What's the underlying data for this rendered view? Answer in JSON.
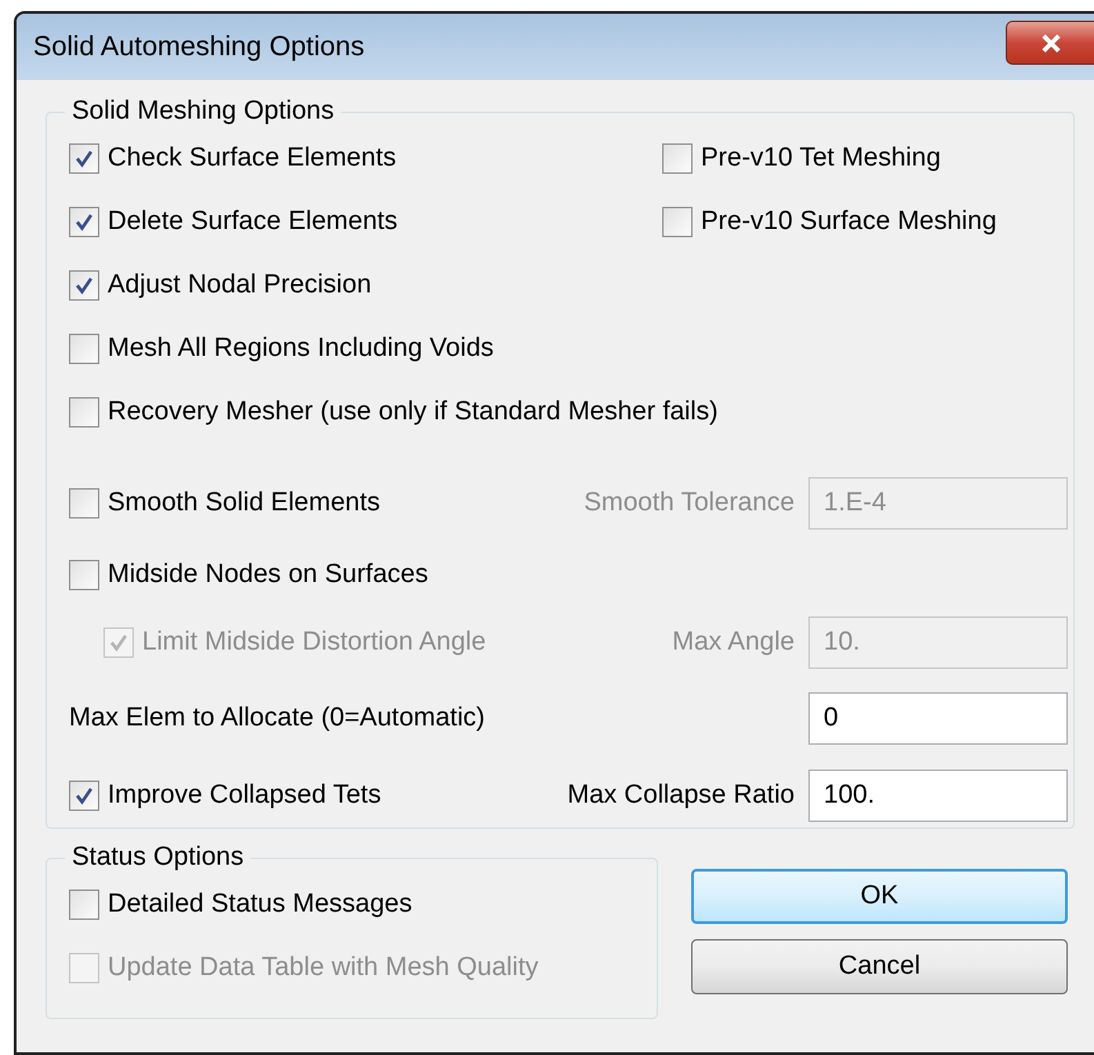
{
  "window": {
    "title": "Solid Automeshing Options"
  },
  "solid_meshing": {
    "legend": "Solid Meshing Options",
    "rows": [
      {
        "kind": "checks",
        "items": [
          {
            "label": "Check Surface Elements",
            "checked": true,
            "disabled": false
          },
          {
            "label": "Pre-v10 Tet Meshing",
            "checked": false,
            "disabled": false
          }
        ]
      },
      {
        "kind": "checks",
        "items": [
          {
            "label": "Delete Surface Elements",
            "checked": true,
            "disabled": false
          },
          {
            "label": "Pre-v10 Surface Meshing",
            "checked": false,
            "disabled": false
          }
        ]
      },
      {
        "kind": "checks",
        "items": [
          {
            "label": "Adjust Nodal Precision",
            "checked": true,
            "disabled": false
          }
        ]
      },
      {
        "kind": "checks",
        "items": [
          {
            "label": "Mesh All Regions Including Voids",
            "checked": false,
            "disabled": false
          }
        ]
      },
      {
        "kind": "checks",
        "items": [
          {
            "label": "Recovery Mesher (use only if Standard Mesher fails)",
            "checked": false,
            "disabled": false
          }
        ]
      },
      {
        "kind": "check_field",
        "check": {
          "label": "Smooth Solid Elements",
          "checked": false,
          "disabled": false
        },
        "field_label": "Smooth Tolerance",
        "field": {
          "value": "1.E-4",
          "disabled": true
        }
      },
      {
        "kind": "checks",
        "items": [
          {
            "label": "Midside Nodes on Surfaces",
            "checked": false,
            "disabled": false
          }
        ]
      },
      {
        "kind": "sub_check_field",
        "check": {
          "label": "Limit Midside Distortion Angle",
          "checked": true,
          "disabled": true
        },
        "field_label": "Max Angle",
        "field": {
          "value": "10.",
          "disabled": true
        }
      },
      {
        "kind": "label_field",
        "label": "Max Elem to Allocate (0=Automatic)",
        "field": {
          "value": "0",
          "disabled": false
        }
      },
      {
        "kind": "check_field",
        "check": {
          "label": "Improve Collapsed Tets",
          "checked": true,
          "disabled": false
        },
        "field_label": "Max Collapse Ratio",
        "field": {
          "value": "100.",
          "disabled": false
        }
      }
    ]
  },
  "status_options": {
    "legend": "Status Options",
    "items": [
      {
        "label": "Detailed Status Messages",
        "checked": false,
        "disabled": false
      },
      {
        "label": "Update Data Table with Mesh Quality",
        "checked": false,
        "disabled": true
      }
    ]
  },
  "buttons": [
    {
      "label": "OK",
      "default": true
    },
    {
      "label": "Cancel",
      "default": false
    }
  ]
}
